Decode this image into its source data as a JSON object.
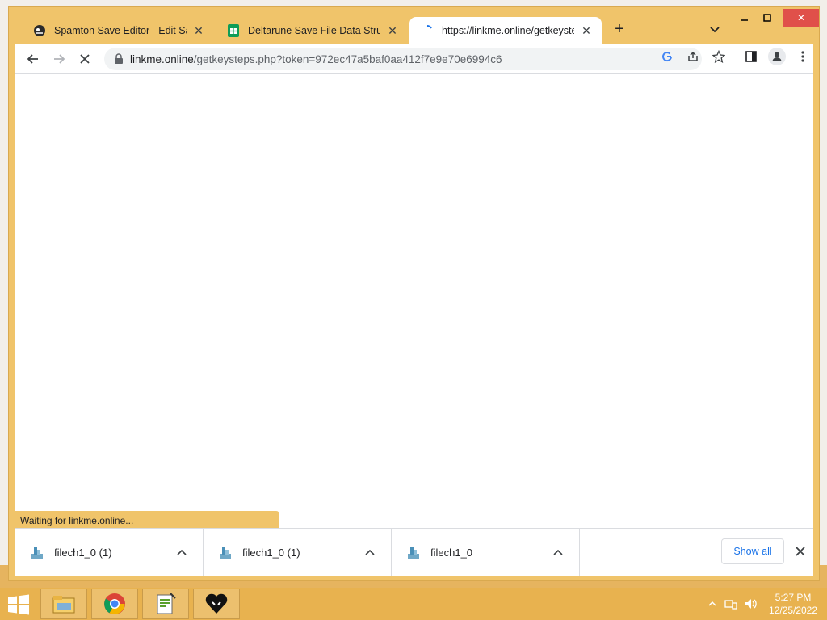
{
  "browser": {
    "tabs": [
      {
        "title": "Spamton Save Editor - Edit Save",
        "favicon": "spamton-icon",
        "active": false
      },
      {
        "title": "Deltarune Save File Data Structure",
        "favicon": "sheets-icon",
        "active": false
      },
      {
        "title": "https://linkme.online/getkeysteps",
        "favicon": "loading-spinner-icon",
        "active": true
      }
    ],
    "url": {
      "domain": "linkme.online",
      "path": "/getkeysteps.php?token=972ec47a5baf0aa412f7e9e70e6994c6"
    },
    "status_text": "Waiting for linkme.online..."
  },
  "downloads": {
    "items": [
      {
        "name": "filech1_0 (1)"
      },
      {
        "name": "filech1_0 (1)"
      },
      {
        "name": "filech1_0"
      }
    ],
    "show_all_label": "Show all"
  },
  "taskbar": {
    "apps": [
      "file-explorer-icon",
      "chrome-icon",
      "notepad-plus-plus-icon",
      "deltarune-heart-icon"
    ],
    "time": "5:27 PM",
    "date": "12/25/2022"
  },
  "colors": {
    "accent": "#f0c46a",
    "taskbar": "#e8b24f",
    "link": "#1a73e8"
  }
}
